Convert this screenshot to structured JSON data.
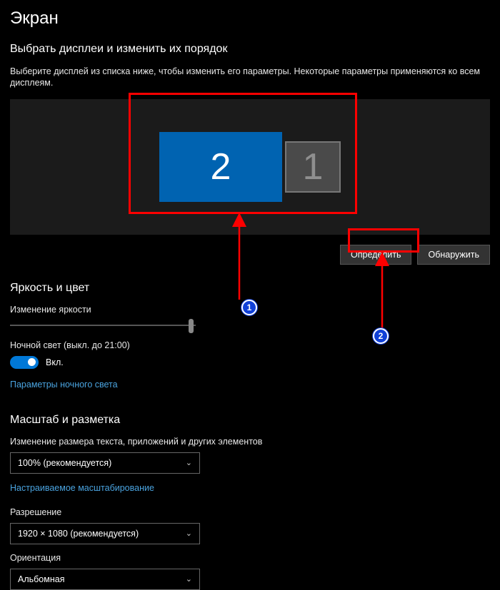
{
  "page": {
    "title": "Экран",
    "arrange_heading": "Выбрать дисплеи и изменить их порядок",
    "arrange_desc": "Выберите дисплей из списка ниже, чтобы изменить его параметры. Некоторые параметры применяются ко всем дисплеям."
  },
  "displays": {
    "items": [
      {
        "id": "2",
        "primary": true
      },
      {
        "id": "1",
        "primary": false
      }
    ],
    "identify_label": "Определить",
    "detect_label": "Обнаружить"
  },
  "brightness": {
    "heading": "Яркость и цвет",
    "slider_label": "Изменение яркости",
    "slider_value_pct": 96
  },
  "nightlight": {
    "label": "Ночной свет (выкл. до 21:00)",
    "toggle_state": "Вкл.",
    "settings_link": "Параметры ночного света"
  },
  "scale": {
    "heading": "Масштаб и разметка",
    "text_size_label": "Изменение размера текста, приложений и других элементов",
    "text_size_value": "100% (рекомендуется)",
    "custom_scaling_link": "Настраиваемое масштабирование",
    "resolution_label": "Разрешение",
    "resolution_value": "1920 × 1080 (рекомендуется)",
    "orientation_label": "Ориентация",
    "orientation_value": "Альбомная"
  },
  "annotations": {
    "badge1": "1",
    "badge2": "2"
  }
}
